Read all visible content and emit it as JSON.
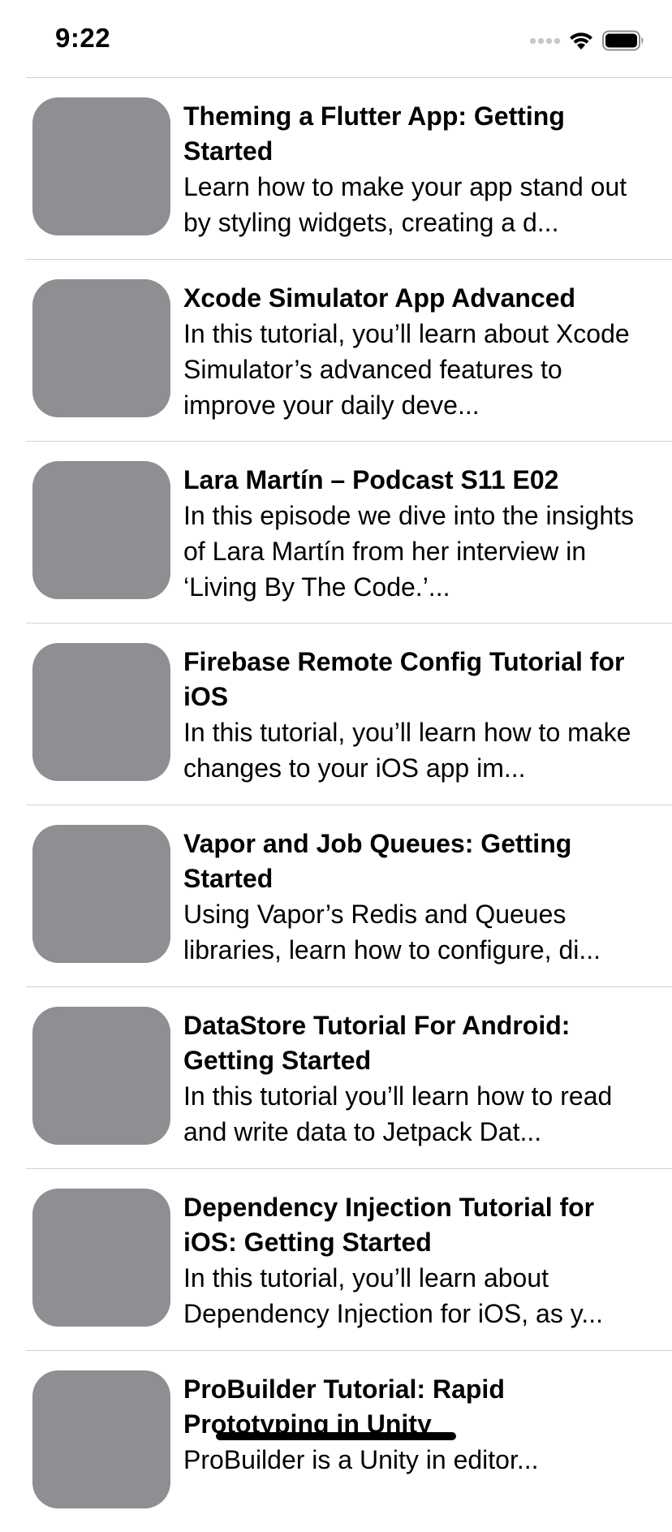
{
  "status_bar": {
    "time": "9:22"
  },
  "icons": {
    "signal": "cellular-signal-icon",
    "wifi": "wifi-icon",
    "battery": "battery-icon"
  },
  "colors": {
    "thumbnail_placeholder": "#8e8e93",
    "separator": "#d1d1d6"
  },
  "items": [
    {
      "title": "Theming a Flutter App: Getting Started",
      "description": "Learn how to make your app stand out by styling widgets, creating a d..."
    },
    {
      "title": "Xcode Simulator App Advanced",
      "description": "In this tutorial, you’ll learn about Xcode Simulator’s advanced features to improve your daily deve..."
    },
    {
      "title": "Lara Martín – Podcast S11 E02",
      "description": "In this episode we dive into the insights of Lara Martín from her interview in ‘Living By The Code.’..."
    },
    {
      "title": "Firebase Remote Config Tutorial for iOS",
      "description": "In this tutorial, you’ll learn how to make changes to your iOS app im..."
    },
    {
      "title": "Vapor and Job Queues: Getting Started",
      "description": "Using Vapor’s Redis and Queues libraries, learn how to configure, di..."
    },
    {
      "title": "DataStore Tutorial For Android: Getting Started",
      "description": "In this tutorial you’ll learn how to read and write data to Jetpack Dat..."
    },
    {
      "title": "Dependency Injection Tutorial for iOS: Getting Started",
      "description": "In this tutorial, you’ll learn about Dependency Injection for iOS, as y..."
    },
    {
      "title": "ProBuilder Tutorial: Rapid Prototyping in Unity",
      "description": "ProBuilder is a Unity in editor..."
    }
  ]
}
